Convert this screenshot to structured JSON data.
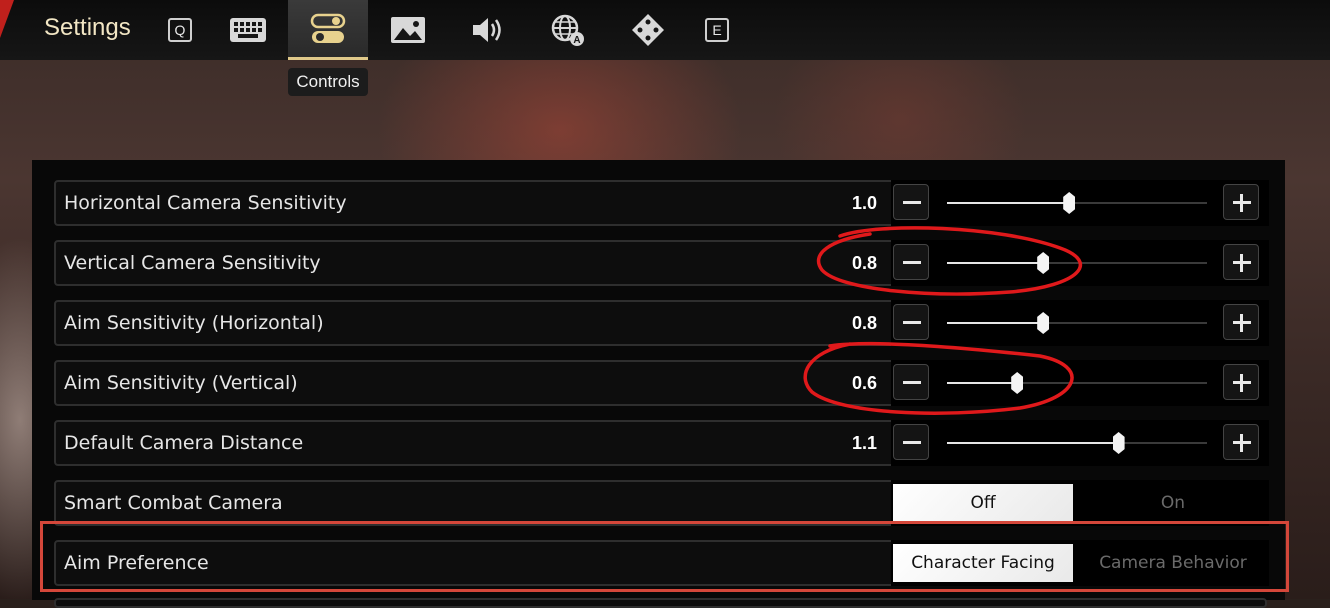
{
  "header": {
    "title": "Settings",
    "tabs": [
      {
        "name": "Q",
        "icon": "q-key-icon"
      },
      {
        "name": "keyboard",
        "icon": "keyboard-icon"
      },
      {
        "name": "controls",
        "icon": "toggle-switch-icon",
        "active": true
      },
      {
        "name": "graphics",
        "icon": "image-icon"
      },
      {
        "name": "audio",
        "icon": "speaker-icon"
      },
      {
        "name": "language",
        "icon": "globe-language-icon"
      },
      {
        "name": "gamepad",
        "icon": "dpad-icon"
      },
      {
        "name": "E",
        "icon": "e-key-icon"
      }
    ],
    "active_tab_tooltip": "Controls"
  },
  "settings": [
    {
      "label": "Horizontal Camera Sensitivity",
      "value": "1.0",
      "type": "slider",
      "level": 0.47
    },
    {
      "label": "Vertical Camera Sensitivity",
      "value": "0.8",
      "type": "slider",
      "level": 0.37
    },
    {
      "label": "Aim Sensitivity (Horizontal)",
      "value": "0.8",
      "type": "slider",
      "level": 0.37
    },
    {
      "label": "Aim Sensitivity (Vertical)",
      "value": "0.6",
      "type": "slider",
      "level": 0.27
    },
    {
      "label": "Default Camera Distance",
      "value": "1.1",
      "type": "slider",
      "level": 0.66
    },
    {
      "label": "Smart Combat Camera",
      "type": "toggle",
      "options": [
        "Off",
        "On"
      ],
      "selected": "Off"
    },
    {
      "label": "Aim Preference",
      "type": "toggle",
      "options": [
        "Character Facing",
        "Camera Behavior"
      ],
      "selected": "Character Facing"
    }
  ],
  "annotation_color": "#d4473a"
}
